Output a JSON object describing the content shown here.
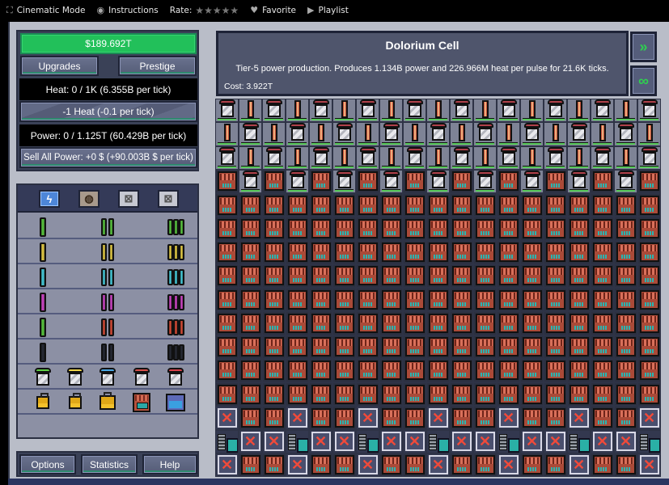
{
  "topbar": {
    "cinematic_label": "Cinematic Mode",
    "cinematic_icon": "fullscreen-icon",
    "instructions_label": "Instructions",
    "instructions_icon": "gamepad-icon",
    "rate_label": "Rate:",
    "rate_stars": "★★★★★",
    "rating_value": 0,
    "rating_max": 5,
    "favorite_label": "Favorite",
    "favorite_icon": "heart-icon",
    "playlist_label": "Playlist",
    "playlist_icon": "play-icon"
  },
  "stats": {
    "money": "$189.692T",
    "heat": "Heat: 0 / 1K (6.355B per tick)",
    "power": "Power: 0 / 1.125T (60.429B per tick)"
  },
  "buttons": {
    "upgrades": "Upgrades",
    "prestige": "Prestige",
    "reduce_heat": "-1 Heat (-0.1 per tick)",
    "sell_power": "Sell All Power: +0 $ (+90.003B $ per tick)",
    "options": "Options",
    "statistics": "Statistics",
    "help": "Help"
  },
  "info": {
    "title": "Dolorium Cell",
    "description": "Tier-5 power production. Produces 1.134B power and 226.966M heat per pulse for 21.6K ticks.",
    "cost": "Cost: 3.922T",
    "next_icon": "chevron-double-right-icon",
    "loop_icon": "infinity-icon"
  },
  "parts_tabs": [
    {
      "name": "power",
      "icon": "lightning-icon",
      "active": true
    },
    {
      "name": "heat",
      "icon": "heat-icon",
      "active": false
    },
    {
      "name": "locked-1",
      "icon": "locked-icon",
      "active": false
    },
    {
      "name": "locked-2",
      "icon": "locked-icon",
      "active": false
    }
  ],
  "parts_rows": [
    {
      "type": "cell",
      "color": "#5fd044",
      "items": [
        "single",
        "double",
        "quad"
      ]
    },
    {
      "type": "cell",
      "color": "#f0d64a",
      "items": [
        "single",
        "double",
        "quad"
      ]
    },
    {
      "type": "cell",
      "color": "#4ad4e4",
      "items": [
        "single",
        "double",
        "quad"
      ]
    },
    {
      "type": "cell",
      "color": "#d84ad0",
      "items": [
        "single",
        "double",
        "quad"
      ]
    },
    {
      "type": "cell",
      "color": "#e0503a",
      "items": [
        "single-green",
        "double",
        "quad"
      ]
    },
    {
      "type": "cell",
      "color": "#2a2d38",
      "items": [
        "single",
        "double",
        "quad"
      ]
    },
    {
      "type": "vent",
      "items": [
        "#5fd044",
        "#f0d64a",
        "#4aa8e4",
        "#d8504a",
        "#d8404a"
      ]
    },
    {
      "type": "capacitor",
      "items": [
        "small",
        "small",
        "medium",
        "red",
        "blue"
      ]
    }
  ],
  "reactor": {
    "columns": 19,
    "rows": 16,
    "legend": {
      "V": "vent",
      "C": "dolorium-cell",
      "P": "capacitor",
      "X": "empty-locked-slot",
      "E": "heat-exchanger"
    },
    "layout": [
      "VCVCVCVCVCVCVCVCVCV",
      "CVCVCVCVCVCVCVCVCVC",
      "VCVCVCVCVCVCVCVCVCV",
      "PVPVPVPVPVPVPVPVPVP",
      "PPPPPPPPPPPPPPPPPPP",
      "PPPPPPPPPPPPPPPPPPP",
      "PPPPPPPPPPPPPPPPPPP",
      "PPPPPPPPPPPPPPPPPPP",
      "PPPPPPPPPPPPPPPPPPP",
      "PPPPPPPPPPPPPPPPPPP",
      "PPPPPPPPPPPPPPPPPPP",
      "PPPPPPPPPPPPPPPPPPP",
      "PPPPPPPPPPPPPPPPPPP",
      "XPPXPPXPPXPPXPPXPPX",
      "EXXEXXEXXEXXEXXEXXE",
      "XPPXPPXPPXPPXPPXPPX"
    ]
  }
}
